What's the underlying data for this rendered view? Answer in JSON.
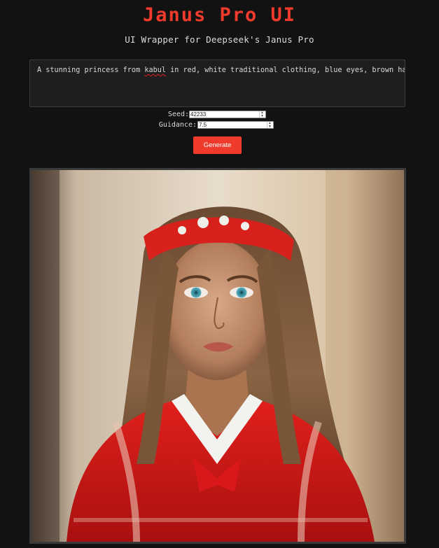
{
  "header": {
    "title": "Janus Pro UI",
    "subtitle": "UI Wrapper for Deepseek's Janus Pro"
  },
  "prompt": {
    "text_before": "A stunning princess from ",
    "misspelled_word": "kabul",
    "text_after": " in red, white traditional clothing, blue eyes, brown hair"
  },
  "seed": {
    "label": "Seed:",
    "value": "42233"
  },
  "guidance": {
    "label": "Guidance:",
    "value": "7.5"
  },
  "generate_button": {
    "label": "Generate"
  },
  "output_image": {
    "subject": "generated portrait image"
  },
  "colors": {
    "accent": "#ef3a2c",
    "background": "#121212",
    "panel": "#1e1e1e"
  }
}
